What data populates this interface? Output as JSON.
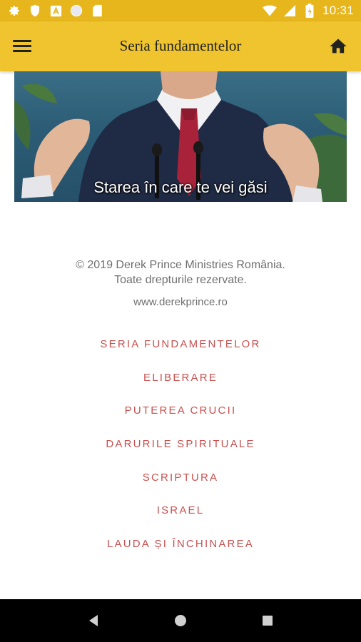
{
  "status_bar": {
    "time": "10:31",
    "left_icons": [
      "gear-icon",
      "shield-icon",
      "font-icon",
      "circle-icon",
      "sd-card-icon"
    ],
    "right_icons": [
      "wifi-icon",
      "signal-icon",
      "battery-charging-icon"
    ],
    "background": "#e6b61c"
  },
  "app_bar": {
    "title": "Seria fundamentelor",
    "background": "#efc42f"
  },
  "video": {
    "caption": "Starea în care te vei găsi"
  },
  "footer": {
    "copyright_line1": "© 2019 Derek Prince Ministries România.",
    "copyright_line2": "Toate drepturile rezervate.",
    "website": "www.derekprince.ro"
  },
  "links": [
    "SERIA FUNDAMENTELOR",
    "ELIBERARE",
    "PUTEREA CRUCII",
    "DARURILE SPIRITUALE",
    "SCRIPTURA",
    "ISRAEL",
    "LAUDA ȘI ÎNCHINAREA"
  ],
  "link_color": "#c8504f",
  "nav_bar": {
    "icons": [
      "back-icon",
      "home-circle-icon",
      "recents-icon"
    ]
  }
}
